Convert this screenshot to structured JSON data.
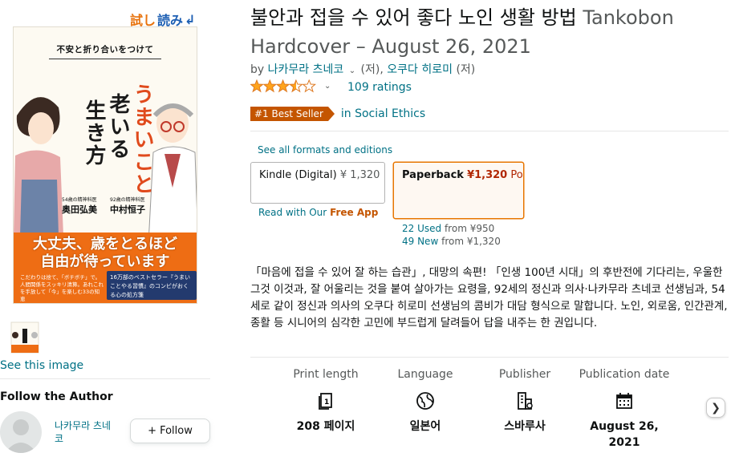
{
  "preview": {
    "tameshi": "試し",
    "yomi": "読み",
    "arrow": "↲"
  },
  "cover": {
    "subtitle": "不安と折り合いをつけて",
    "title_red": "うまいこと",
    "title_2": "老いる",
    "title_3": "生き方",
    "author1_role": "54歳の精神科医",
    "author1": "奥田弘美",
    "author2_role": "92歳の精神科医",
    "author2": "中村恒子",
    "band_line1": "大丈夫、歳をとるほど",
    "band_line2": "自由が待っています",
    "band_small": "こだわりは捨て、「ボチボチ」で。人間関係をスッキリ清算。あれこれを手放して「今」を楽しむ33の知恵",
    "ribbon": "16万部のベストセラー『うまいことやる習慣』のコンビがおくる心の処方箋"
  },
  "left": {
    "see_image": "See this image",
    "follow_heading": "Follow the Author",
    "author_name": "나카무라 츠네코",
    "follow_button": "Follow",
    "follow_plus": "+"
  },
  "product": {
    "title": "불안과 접을 수 있어 좋다 노인 생활 방법",
    "format": "Tankobon Hardcover – August 26, 2021",
    "by": "by",
    "author1": "나카무라 츠네코",
    "author1_role": "(저),",
    "author2": "오쿠다 히로미",
    "author2_role": "(저)",
    "rating_value": 3.5,
    "ratings_count": "109 ratings",
    "badge": "#1 Best Seller",
    "badge_category": "in Social Ethics"
  },
  "formats": {
    "see_all": "See all formats and editions",
    "kindle_label": "Kindle (Digital)",
    "kindle_price": "¥ 1,320",
    "paperback_label": "Paperback",
    "paperback_price": "¥1,320",
    "paperback_more": "Po",
    "free_app_prefix": "Read with Our",
    "free_app": "Free App",
    "used_link": "22 Used",
    "used_price": "from ¥950",
    "new_link": "49 New",
    "new_price": "from ¥1,320"
  },
  "description": "「마음에 접을 수 있어 잘 하는 습관」, 대망의 속편! 「인생 100년 시대」의 후반전에 기다리는, 우울한 그것 이것과, 잘 어울리는 것을 붙여 살아가는 요령을, 92세의 정신과 의사·나카무라 츠네코 선생님과, 54세로 같이 정신과 의사의 오쿠다 히로미 선생님의 콤비가 대담 형식으로 말합니다. 노인, 외로움, 인간관계, 종활 등 시니어의 심각한 고민에 부드럽게 달려들어 답을 내주는 한 권입니다.",
  "details": [
    {
      "label": "Print length",
      "icon": "book-pages-icon",
      "value": "208 페이지"
    },
    {
      "label": "Language",
      "icon": "globe-icon",
      "value": "일본어"
    },
    {
      "label": "Publisher",
      "icon": "building-icon",
      "value": "스바루사"
    },
    {
      "label": "Publication date",
      "icon": "calendar-icon",
      "value": "August 26, 2021"
    }
  ],
  "colors": {
    "link": "#007185",
    "badge": "#C45500",
    "star": "#FFA41C",
    "price": "#B12704",
    "selected_border": "#e77600"
  }
}
